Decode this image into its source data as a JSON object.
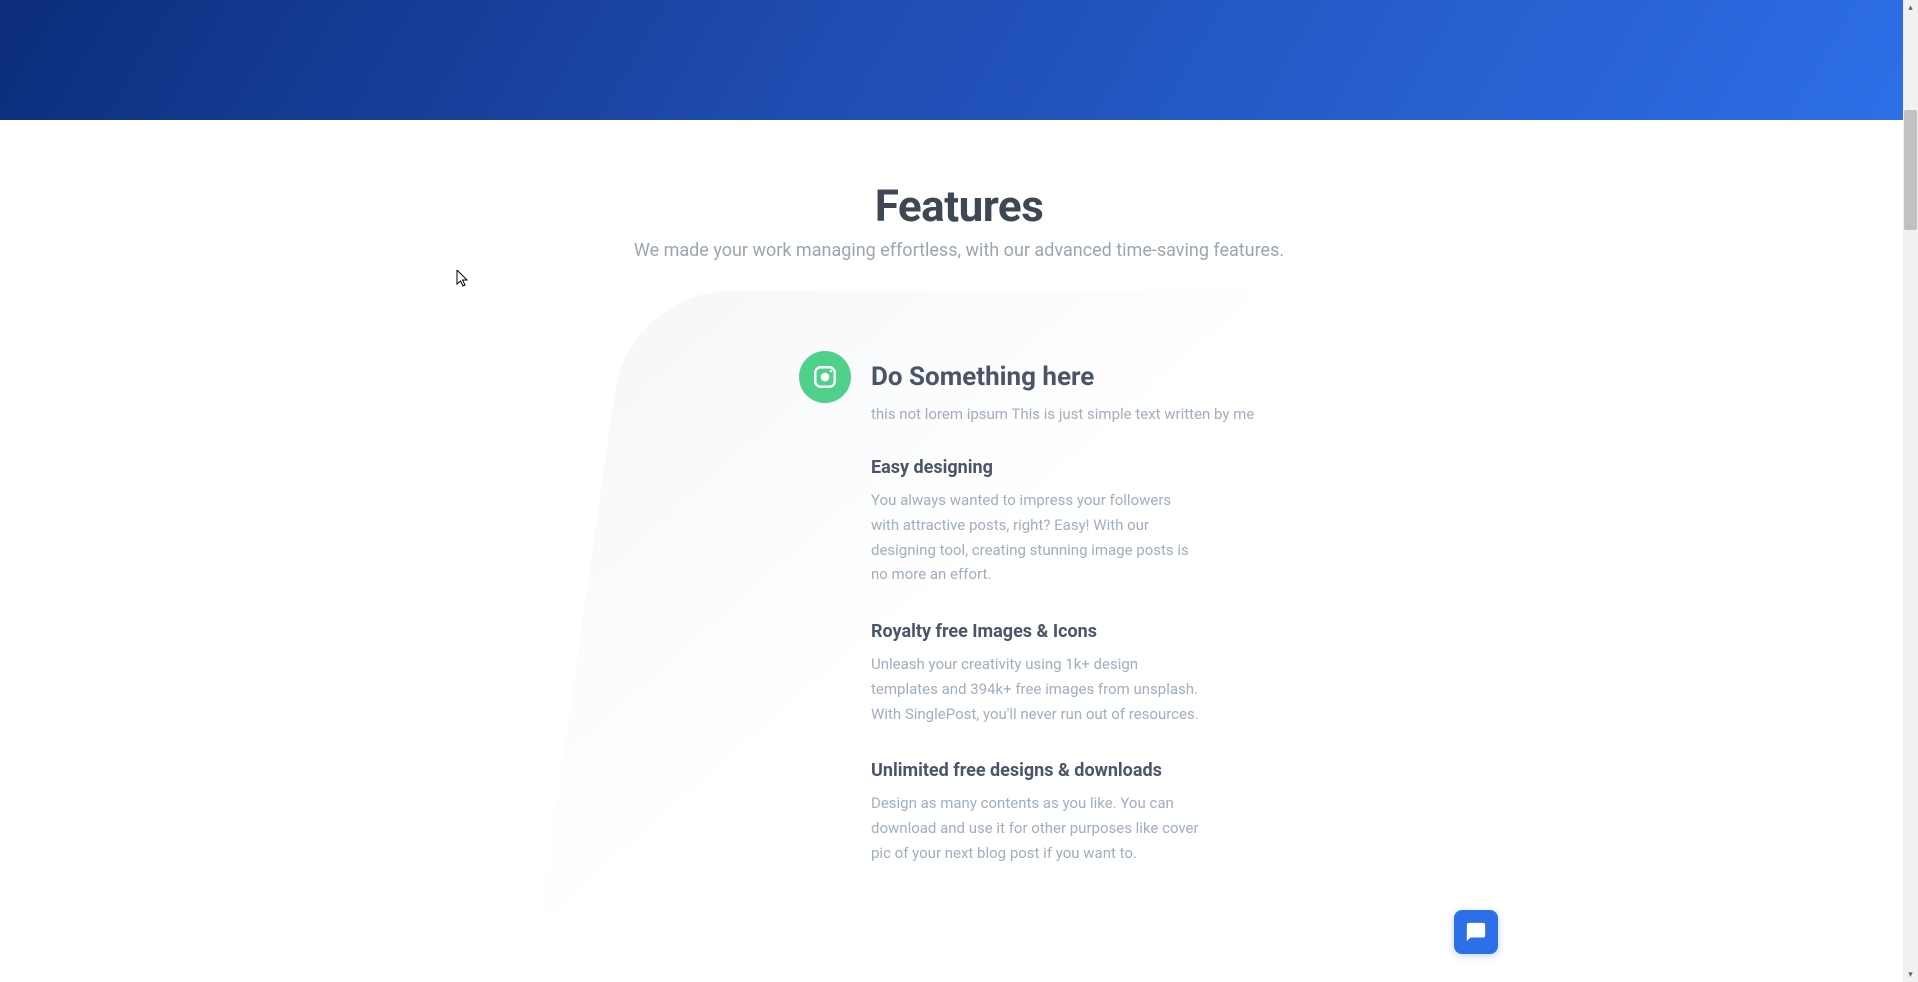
{
  "hero": {},
  "section": {
    "title": "Features",
    "subtitle": "We made your work managing effortless, with our advanced time-saving features."
  },
  "feature_card": {
    "icon_name": "instagram-icon",
    "main_title": "Do Something here",
    "main_subtitle": "this not lorem ipsum This is just simple text written by me",
    "blocks": [
      {
        "title": "Easy designing",
        "desc": "You always wanted to impress your followers with attractive posts, right? Easy! With our designing tool, creating stunning image posts is no more an effort."
      },
      {
        "title": "Royalty free Images & Icons",
        "desc": "Unleash your creativity using 1k+ design templates and 394k+ free images from unsplash. With SinglePost, you'll never run out of resources."
      },
      {
        "title": "Unlimited free designs & downloads",
        "desc": "Design as many contents as you like. You can download and use it for other purposes like cover pic of your next blog post if you want to."
      }
    ]
  },
  "chat": {
    "icon_name": "chat-icon"
  },
  "colors": {
    "accent_green": "#4fd18b",
    "accent_blue": "#2d6fe8",
    "text_dark": "#4a5568",
    "text_light": "#a0aec0"
  }
}
